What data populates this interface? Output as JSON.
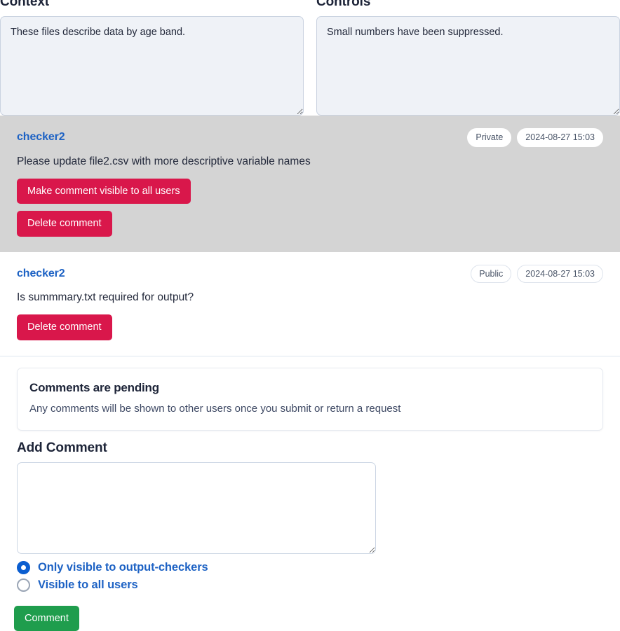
{
  "top_fields": [
    {
      "label": "Context",
      "value": "These files describe data by age band.",
      "placeholder": ""
    },
    {
      "label": "Controls",
      "value": "Small numbers have been suppressed.",
      "placeholder": ""
    }
  ],
  "comments": [
    {
      "author": "checker2",
      "visibility_badge": "Private",
      "timestamp": "2024-08-27 15:03",
      "body": "Please update file2.csv with more descriptive variable names",
      "actions": [
        "Make comment visible to all users",
        "Delete comment"
      ]
    },
    {
      "author": "checker2",
      "visibility_badge": "Public",
      "timestamp": "2024-08-27 15:03",
      "body": "Is summmary.txt required for output?",
      "actions": [
        "Delete comment"
      ]
    }
  ],
  "pending_notice": {
    "title": "Comments are pending",
    "text": "Any comments will be shown to other users once you submit or return a request"
  },
  "add_comment": {
    "heading": "Add Comment",
    "value": "",
    "placeholder": "",
    "visibility_options": [
      {
        "label": "Only visible to output-checkers",
        "selected": true
      },
      {
        "label": "Visible to all users",
        "selected": false
      }
    ],
    "submit_label": "Comment"
  },
  "colors": {
    "danger": "#d9174b",
    "success": "#1f9d4d",
    "link": "#1d62c4",
    "radio_selected": "#0b5ed0",
    "private_block_bg": "#d4d4d4",
    "readonly_field_bg": "#eff2f7"
  }
}
